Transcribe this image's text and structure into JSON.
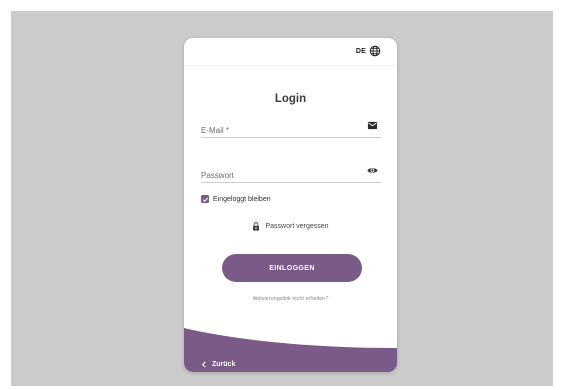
{
  "header": {
    "language_code": "DE",
    "language_icon": "globe-icon"
  },
  "login": {
    "title": "Login",
    "email": {
      "placeholder": "E-Mail *",
      "value": "",
      "icon": "envelope-icon"
    },
    "password": {
      "placeholder": "Passwort",
      "value": "",
      "icon": "eye-icon"
    },
    "remember": {
      "label": "Eingeloggt bleiben",
      "checked": true
    },
    "forgot_password": {
      "label": "Passwort vergessen",
      "icon": "lock-icon"
    },
    "submit_label": "EINLOGGEN",
    "activation_link": "Aktivierungslink nicht erhalten?"
  },
  "footer": {
    "back_label": "Zurück",
    "back_icon": "chevron-left-icon"
  },
  "colors": {
    "accent": "#7a5a86",
    "background": "#cbcbcb",
    "card": "#ffffff"
  }
}
